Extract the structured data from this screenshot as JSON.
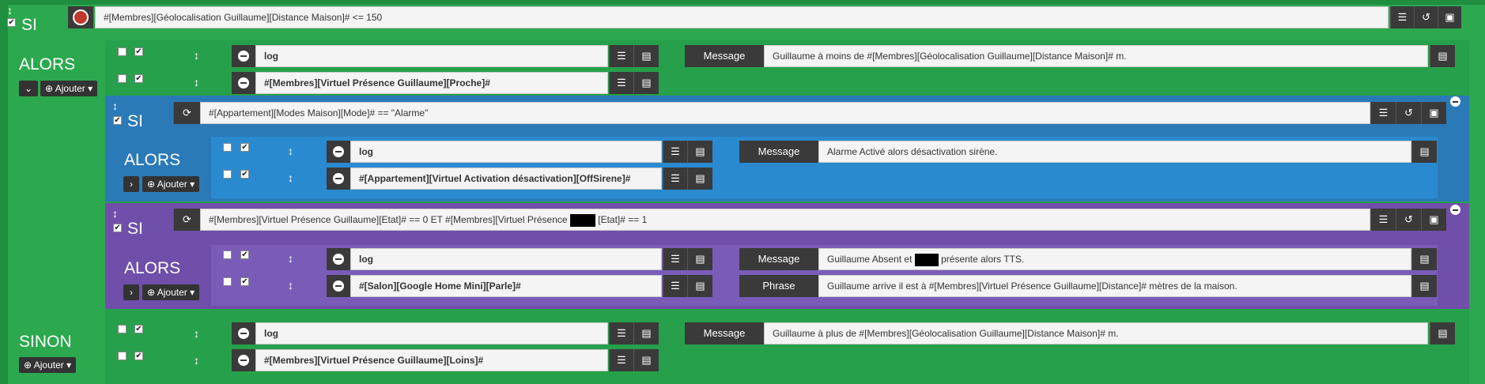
{
  "root_if": {
    "si_label": "SI",
    "condition": "#[Membres][Géolocalisation Guillaume][Distance Maison]# <= 150",
    "alors_label": "ALORS",
    "add_label": "Ajouter",
    "actions": [
      {
        "cmd": "log",
        "option_label": "Message",
        "option_value": "Guillaume à moins de #[Membres][Géolocalisation Guillaume][Distance Maison]# m."
      },
      {
        "cmd": "#[Membres][Virtuel Présence Guillaume][Proche]#"
      }
    ],
    "sub_if_1": {
      "si_label": "SI",
      "condition": "#[Appartement][Modes Maison][Mode]# == \"Alarme\"",
      "alors_label": "ALORS",
      "add_label": "Ajouter",
      "actions": [
        {
          "cmd": "log",
          "option_label": "Message",
          "option_value": "Alarme Activé alors désactivation sirène."
        },
        {
          "cmd": "#[Appartement][Virtuel Activation désactivation][OffSirene]#"
        }
      ]
    },
    "sub_if_2": {
      "si_label": "SI",
      "condition_a": "#[Membres][Virtuel Présence Guillaume][Etat]# == 0  ET #[Membres][Virtuel Présence",
      "condition_b": "[Etat]# == 1",
      "alors_label": "ALORS",
      "add_label": "Ajouter",
      "actions": [
        {
          "cmd": "log",
          "option_label": "Message",
          "option_value_a": "Guillaume Absent et",
          "option_value_b": "présente alors TTS."
        },
        {
          "cmd": "#[Salon][Google Home Mini][Parle]#",
          "option_label": "Phrase",
          "option_value": "Guillaume arrive il est à #[Membres][Virtuel Présence Guillaume][Distance]# mètres de la maison."
        }
      ]
    },
    "sinon_label": "SINON",
    "sinon_add_label": "Ajouter",
    "sinon_actions": [
      {
        "cmd": "log",
        "option_label": "Message",
        "option_value": "Guillaume à plus de #[Membres][Géolocalisation Guillaume][Distance Maison]# m."
      },
      {
        "cmd": "#[Membres][Virtuel Présence Guillaume][Loins]#"
      }
    ]
  },
  "colors": {
    "green": "#2ea84f",
    "blue": "#2b7ab8",
    "purple": "#6f4fa9",
    "dark": "#3a3a3a"
  }
}
